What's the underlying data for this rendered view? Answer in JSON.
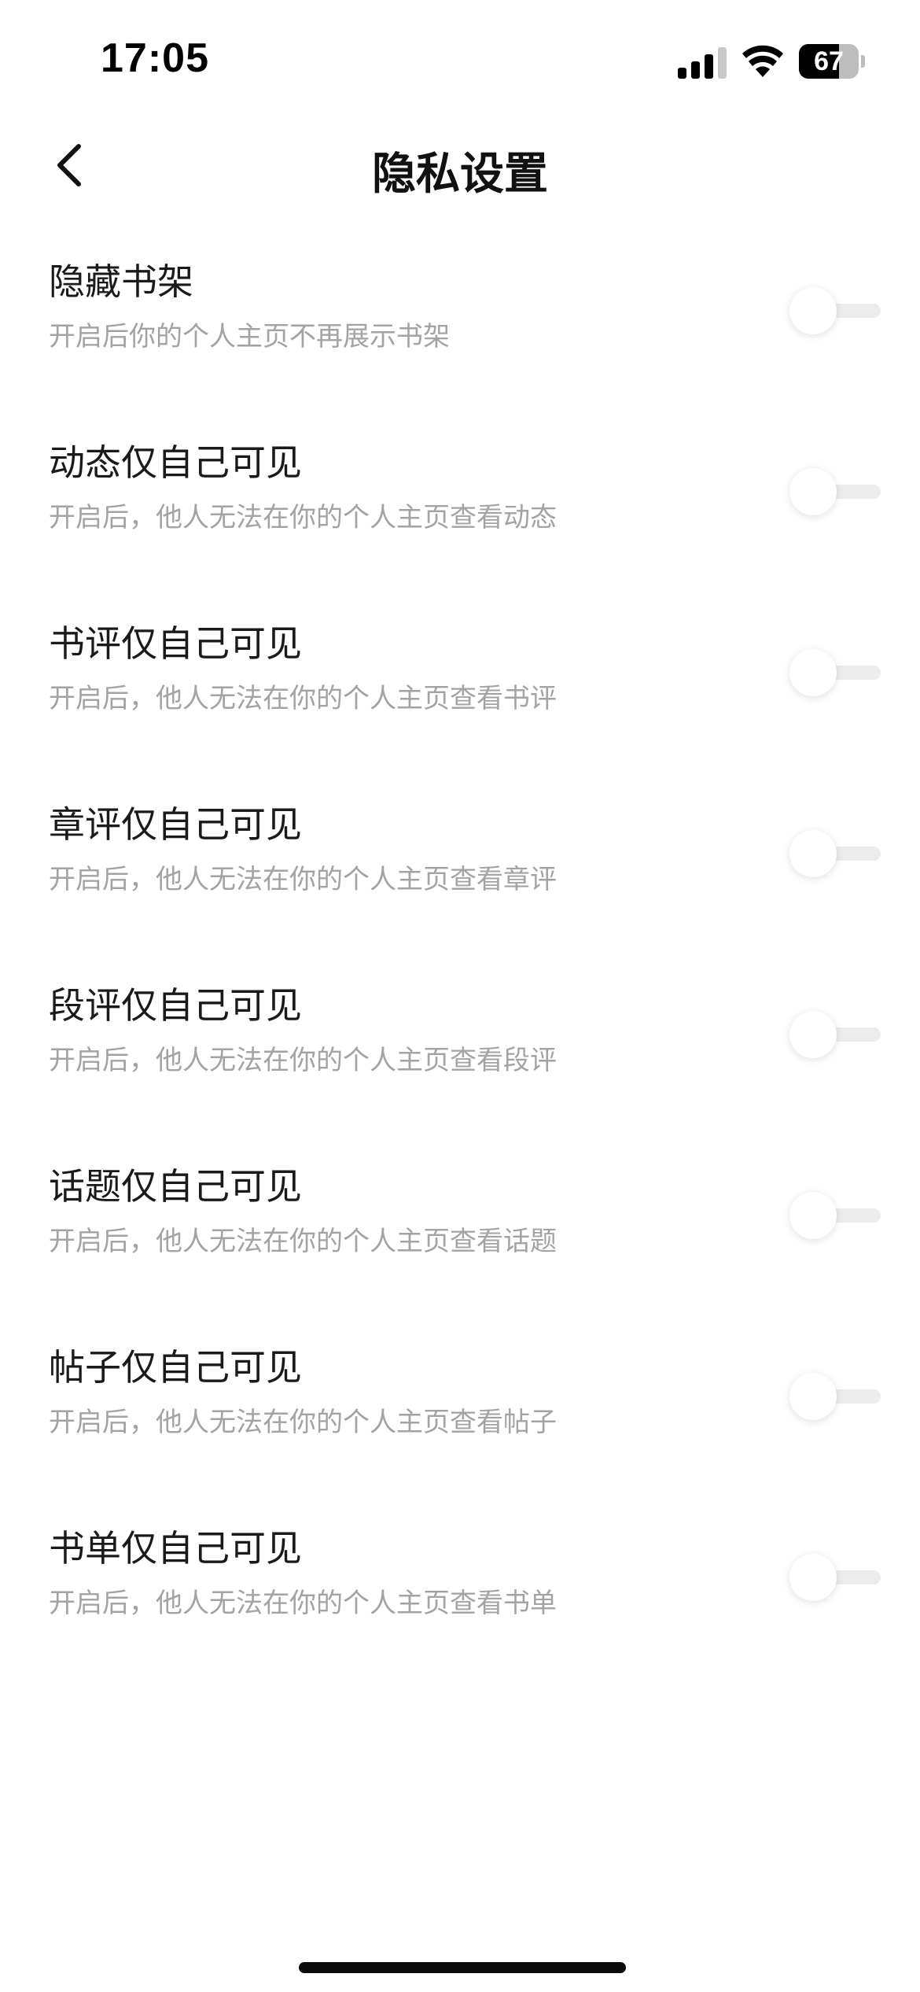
{
  "status_bar": {
    "time": "17:05",
    "battery_level": 67,
    "battery_text": "67"
  },
  "header": {
    "title": "隐私设置",
    "back_icon": "chevron-left-icon"
  },
  "settings": [
    {
      "title": "隐藏书架",
      "description": "开启后你的个人主页不再展示书架",
      "enabled": false
    },
    {
      "title": "动态仅自己可见",
      "description": "开启后，他人无法在你的个人主页查看动态",
      "enabled": false
    },
    {
      "title": "书评仅自己可见",
      "description": "开启后，他人无法在你的个人主页查看书评",
      "enabled": false
    },
    {
      "title": "章评仅自己可见",
      "description": "开启后，他人无法在你的个人主页查看章评",
      "enabled": false
    },
    {
      "title": "段评仅自己可见",
      "description": "开启后，他人无法在你的个人主页查看段评",
      "enabled": false
    },
    {
      "title": "话题仅自己可见",
      "description": "开启后，他人无法在你的个人主页查看话题",
      "enabled": false
    },
    {
      "title": "帖子仅自己可见",
      "description": "开启后，他人无法在你的个人主页查看帖子",
      "enabled": false
    },
    {
      "title": "书单仅自己可见",
      "description": "开启后，他人无法在你的个人主页查看书单",
      "enabled": false
    }
  ],
  "colors": {
    "title_text": "#1a1a1a",
    "description_text": "#a3a3a3",
    "toggle_track_off": "#ececec",
    "background": "#ffffff"
  }
}
